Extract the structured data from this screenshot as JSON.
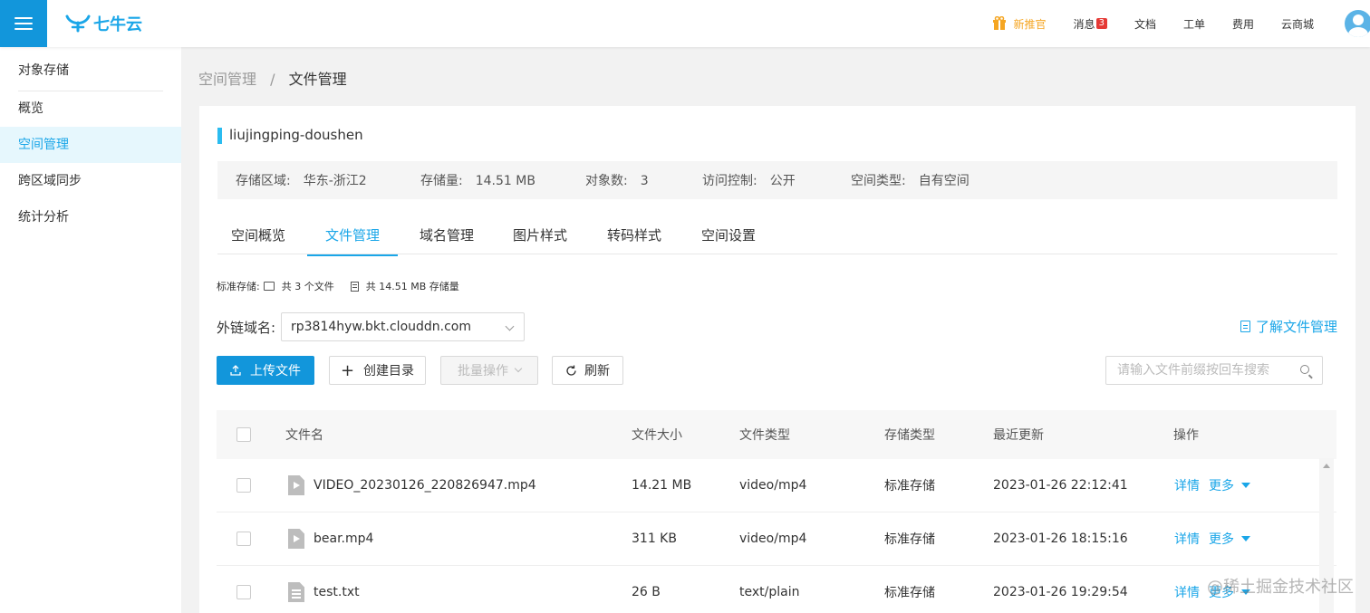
{
  "topbar": {
    "logo_text": "七牛云",
    "nav": [
      {
        "label": "新推官",
        "highlight": true
      },
      {
        "label": "消息",
        "badge": "3"
      },
      {
        "label": "文档"
      },
      {
        "label": "工单"
      },
      {
        "label": "费用"
      },
      {
        "label": "云商城"
      }
    ]
  },
  "sidebar": {
    "title": "对象存储",
    "items": [
      "概览",
      "空间管理",
      "跨区域同步",
      "统计分析"
    ],
    "active_index": 1
  },
  "breadcrumb": {
    "parent": "空间管理",
    "separator": "/",
    "current": "文件管理"
  },
  "bucket": {
    "name": "liujingping-doushen",
    "info": [
      {
        "label": "存储区域:",
        "value": "华东-浙江2"
      },
      {
        "label": "存储量:",
        "value": "14.51 MB"
      },
      {
        "label": "对象数:",
        "value": "3"
      },
      {
        "label": "访问控制:",
        "value": "公开"
      },
      {
        "label": "空间类型:",
        "value": "自有空间"
      }
    ]
  },
  "tabs": [
    "空间概览",
    "文件管理",
    "域名管理",
    "图片样式",
    "转码样式",
    "空间设置"
  ],
  "summary": {
    "label": "标准存储:",
    "files": "共 3 个文件",
    "storage": "共 14.51 MB 存储量"
  },
  "domain": {
    "label": "外链域名:",
    "value": "rp3814hyw.bkt.clouddn.com"
  },
  "learn_link": "了解文件管理",
  "toolbar": {
    "upload": "上传文件",
    "mkdir": "创建目录",
    "batch": "批量操作",
    "refresh": "刷新",
    "search_placeholder": "请输入文件前缀按回车搜索"
  },
  "table": {
    "headers": [
      "文件名",
      "文件大小",
      "文件类型",
      "存储类型",
      "最近更新",
      "操作"
    ],
    "rows": [
      {
        "name": "VIDEO_20230126_220826947.mp4",
        "size": "14.21 MB",
        "type": "video/mp4",
        "storage": "标准存储",
        "updated": "2023-01-26 22:12:41",
        "icon": "video-file-icon"
      },
      {
        "name": "bear.mp4",
        "size": "311 KB",
        "type": "video/mp4",
        "storage": "标准存储",
        "updated": "2023-01-26 18:15:16",
        "icon": "video-file-icon"
      },
      {
        "name": "test.txt",
        "size": "26 B",
        "type": "text/plain",
        "storage": "标准存储",
        "updated": "2023-01-26 19:29:54",
        "icon": "text-file-icon"
      }
    ],
    "op_detail": "详情",
    "op_more": "更多"
  },
  "watermark": "@稀土掘金技术社区",
  "colors": {
    "accent": "#1296db",
    "link": "#1aa6e8",
    "highlight": "#f5a623",
    "badge": "#e53935"
  }
}
